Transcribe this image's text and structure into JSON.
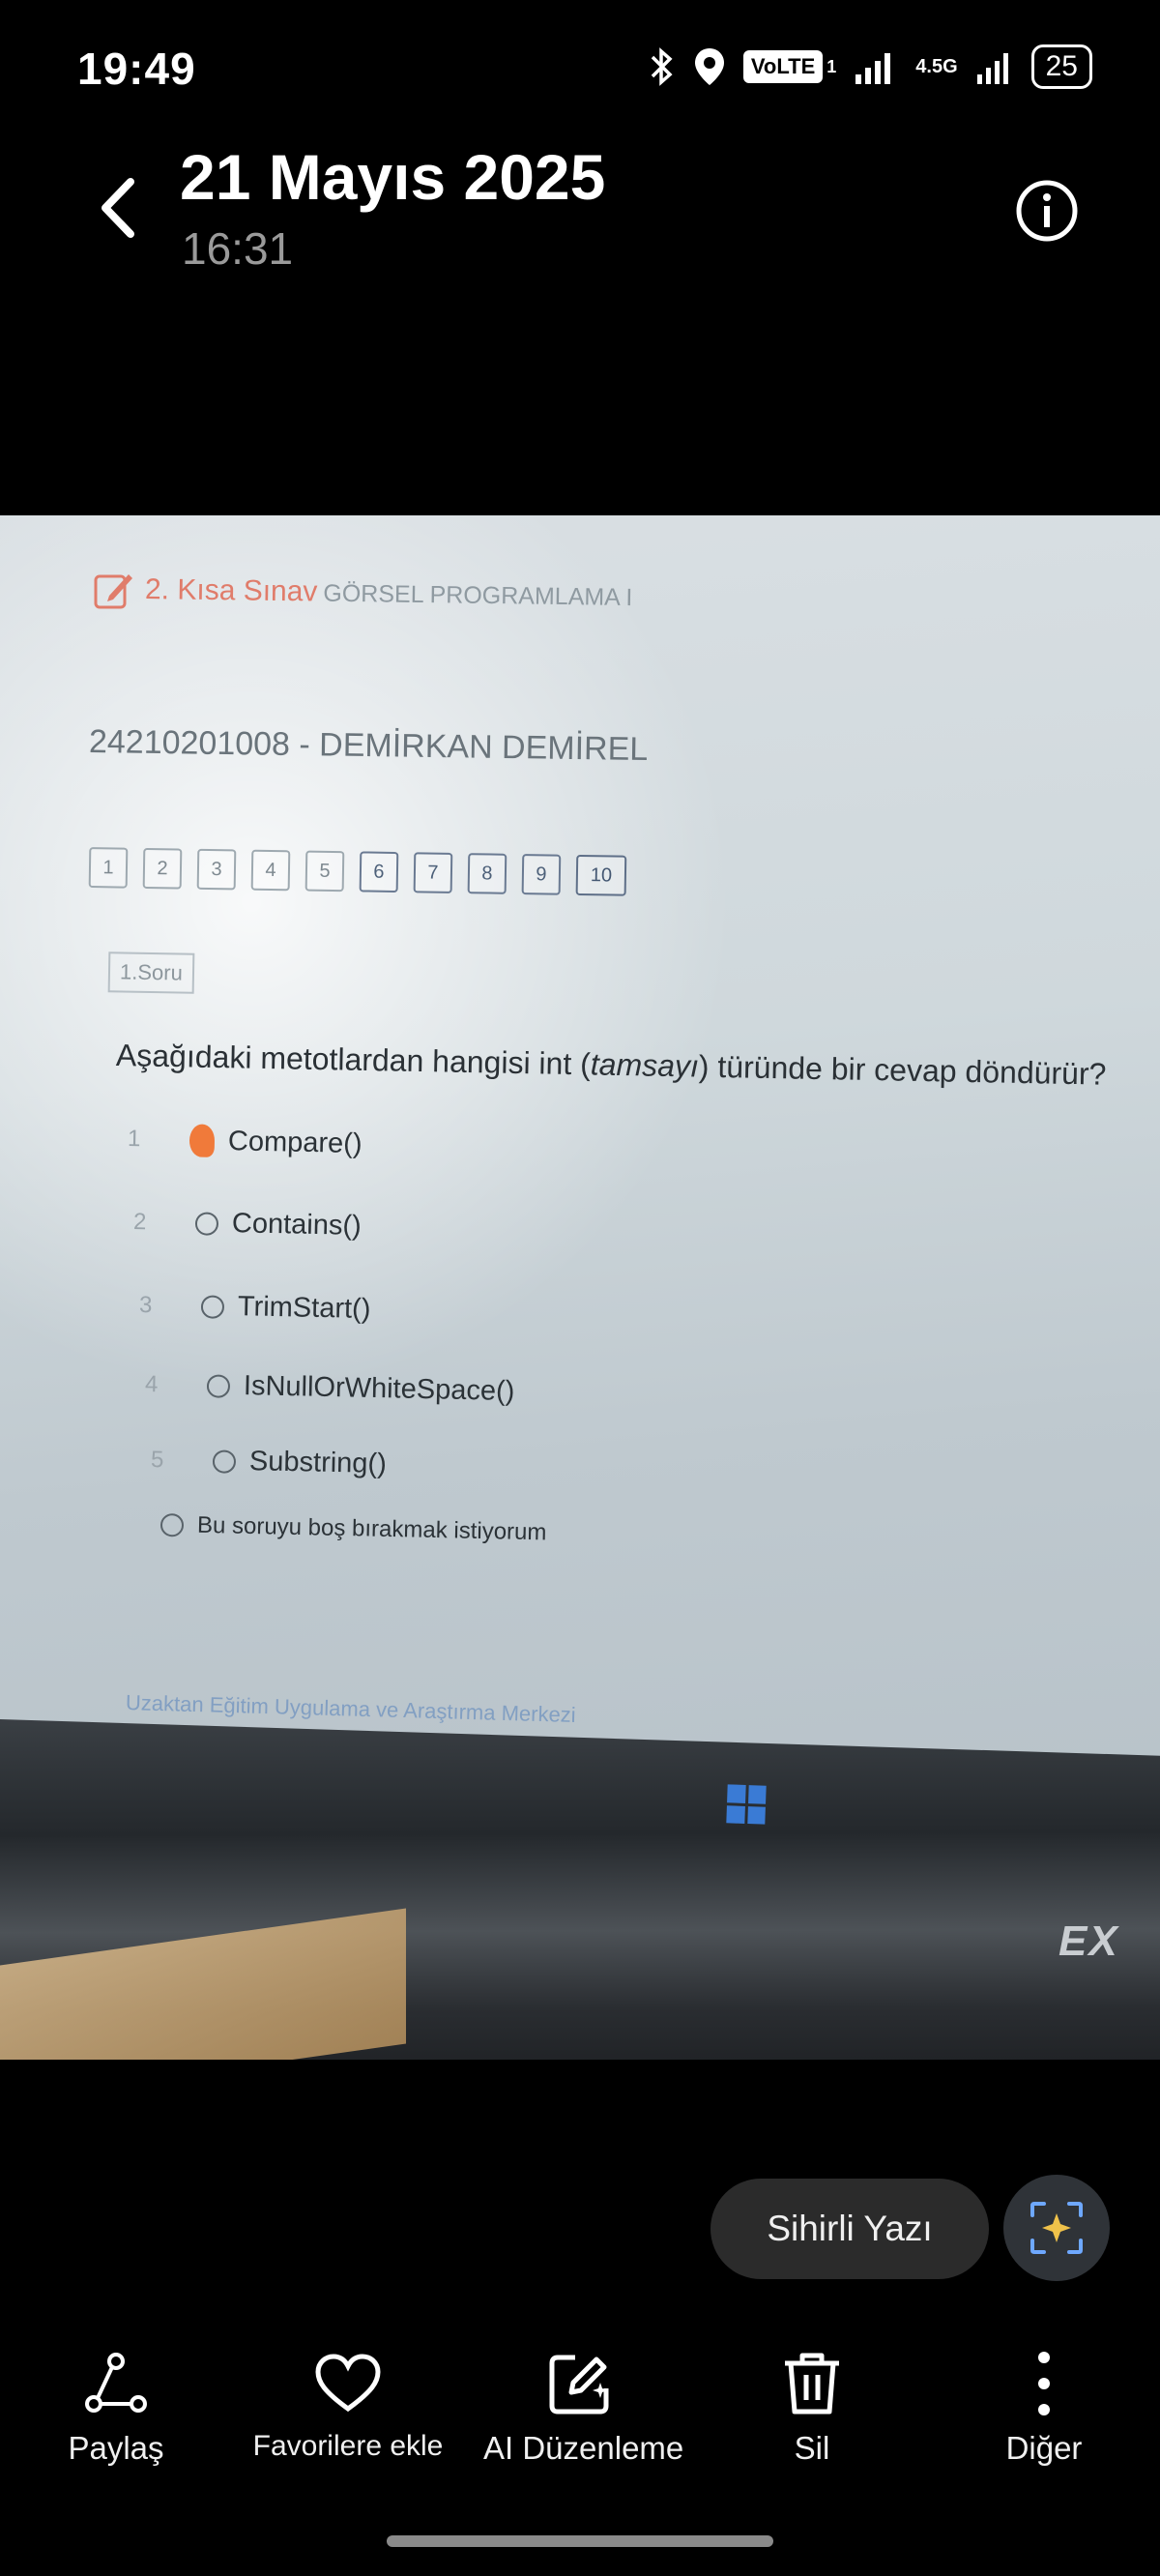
{
  "status_bar": {
    "time": "19:49",
    "volte": "VoLTE",
    "sim_index": "1",
    "network": "4.5G",
    "battery": "25"
  },
  "header": {
    "date": "21 Mayıs 2025",
    "time": "16:31"
  },
  "photo": {
    "quiz_title": "2. Kısa Sınav",
    "course": "GÖRSEL PROGRAMLAMA I",
    "student": "24210201008 - DEMİRKAN DEMİREL",
    "question_nav": [
      "1",
      "2",
      "3",
      "4",
      "5",
      "6",
      "7",
      "8",
      "9",
      "10"
    ],
    "question_tag": "1.Soru",
    "question_before": "Aşağıdaki metotlardan hangisi int (",
    "question_italic": "tamsayı",
    "question_after": ") türünde bir cevap döndürür?",
    "options": [
      {
        "num": "1",
        "label": "Compare()",
        "selected": true
      },
      {
        "num": "2",
        "label": "Contains()",
        "selected": false
      },
      {
        "num": "3",
        "label": "TrimStart()",
        "selected": false
      },
      {
        "num": "4",
        "label": "IsNullOrWhiteSpace()",
        "selected": false
      },
      {
        "num": "5",
        "label": "Substring()",
        "selected": false
      }
    ],
    "skip_option": "Bu soruyu boş bırakmak istiyorum",
    "footer": "Uzaktan Eğitim Uygulama ve Araştırma Merkezi",
    "laptop_brand": "EX"
  },
  "actions": {
    "magic_text": "Sihirli Yazı"
  },
  "toolbar": {
    "share": "Paylaş",
    "favorite": "Favorilere ekle",
    "ai_edit": "AI Düzenleme",
    "delete": "Sil",
    "more": "Diğer"
  },
  "colors": {
    "accent_selected": "#f07a3a",
    "title_red": "#e07c6a"
  }
}
